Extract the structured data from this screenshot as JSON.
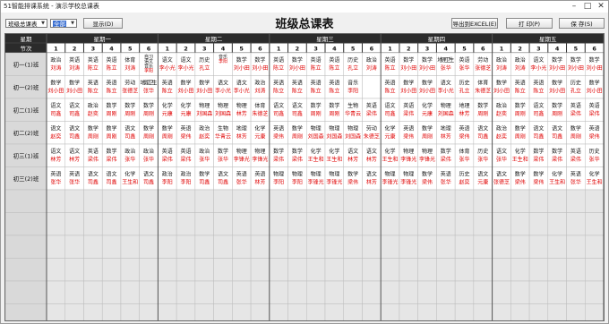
{
  "window": {
    "title": "51智能排课系统 - 演示学校总课表",
    "minimize_icon": "minimize-icon",
    "maximize_icon": "maximize-icon",
    "close_icon": "close-icon"
  },
  "toolbar": {
    "view_select": "班级总课表",
    "group_select": "全部",
    "show_label": "显示(D)",
    "export_label": "导出到EXCEL(E)",
    "print_label": "打 印(P)",
    "save_label": "保 存(S)"
  },
  "heading": "班级总课表",
  "table": {
    "corner_top": "星期",
    "corner_bottom": "节次",
    "days": [
      "星期一",
      "星期二",
      "星期三",
      "星期四",
      "星期五"
    ],
    "periods": [
      "1",
      "2",
      "3",
      "4",
      "5",
      "6"
    ],
    "rows": [
      {
        "label": "初一(1)班",
        "cells": [
          [
            "政治",
            "刘涛"
          ],
          [
            "英语",
            "刘涛"
          ],
          [
            "英语",
            "陈立"
          ],
          [
            "英语",
            "陈立"
          ],
          [
            "体育",
            "刘涛"
          ],
          [
            "自习|语文|音乐|李阳",
            ""
          ],
          [
            "语文",
            "李小光"
          ],
          [
            "语文",
            "李小光"
          ],
          [
            "历史",
            "孔立"
          ],
          [
            "音乐|李阳",
            ""
          ],
          [
            "数学",
            "刘小田"
          ],
          [
            "数学",
            "刘小田"
          ],
          [
            "英语",
            "陈立"
          ],
          [
            "数学",
            "刘小田"
          ],
          [
            "英语",
            "陈立"
          ],
          [
            "英语",
            "陈立"
          ],
          [
            "历史",
            "孔立"
          ],
          [
            "政治",
            "刘涛"
          ],
          [
            "英语",
            "陈立"
          ],
          [
            "数学",
            "刘小田"
          ],
          [
            "数学",
            "刘小田"
          ],
          [
            "地理卫生",
            "张华"
          ],
          [
            "英语",
            "张华"
          ],
          [
            "劳动",
            "张德芝"
          ],
          [
            "政治",
            "刘涛"
          ],
          [
            "政治",
            "刘涛"
          ],
          [
            "语文",
            "李小光"
          ],
          [
            "数学",
            "刘小田"
          ],
          [
            "数学",
            "刘小田"
          ],
          [
            "数学",
            "刘小田"
          ]
        ]
      },
      {
        "label": "初一(2)班",
        "cells": [
          [
            "数学",
            "刘小田"
          ],
          [
            "数学",
            "刘小田"
          ],
          [
            "英语",
            "陈立"
          ],
          [
            "英语",
            "陈立"
          ],
          [
            "劳动",
            "张德芝"
          ],
          [
            "地理卫生",
            "张华"
          ],
          [
            "英语",
            "陈立"
          ],
          [
            "数学",
            "刘小田"
          ],
          [
            "数学",
            "刘小田"
          ],
          [
            "语文",
            "李小光"
          ],
          [
            "语文",
            "李小光"
          ],
          [
            "政治",
            "刘涛"
          ],
          [
            "英语",
            "陈立"
          ],
          [
            "英语",
            "陈立"
          ],
          [
            "英语",
            "陈立"
          ],
          [
            "英语",
            "陈立"
          ],
          [
            "音乐",
            "李阳"
          ],
          [
            "",
            ""
          ],
          [
            "英语",
            "陈立"
          ],
          [
            "数学",
            "刘小田"
          ],
          [
            "数学",
            "刘小田"
          ],
          [
            "语文",
            "李小光"
          ],
          [
            "历史",
            "孔立"
          ],
          [
            "体育",
            "朱德芝"
          ],
          [
            "数学",
            "刘小田"
          ],
          [
            "英语",
            "陈立"
          ],
          [
            "英语",
            "陈立"
          ],
          [
            "数学",
            "刘小田"
          ],
          [
            "历史",
            "孔立"
          ],
          [
            "数学",
            "刘小田"
          ]
        ]
      },
      {
        "label": "初二(1)班",
        "cells": [
          [
            "语文",
            "司鑫"
          ],
          [
            "语文",
            "司鑫"
          ],
          [
            "政治",
            "赵奕"
          ],
          [
            "数学",
            "周刚"
          ],
          [
            "数学",
            "周刚"
          ],
          [
            "数学",
            "周刚"
          ],
          [
            "化学",
            "元康"
          ],
          [
            "化学",
            "元康"
          ],
          [
            "物理",
            "刘国森"
          ],
          [
            "物理",
            "刘国森"
          ],
          [
            "物理",
            "林芳"
          ],
          [
            "体育",
            "朱德芝"
          ],
          [
            "语文",
            "司鑫"
          ],
          [
            "语文",
            "司鑫"
          ],
          [
            "数学",
            "周刚"
          ],
          [
            "数学",
            "周刚"
          ],
          [
            "生物",
            "华青云"
          ],
          [
            "英语",
            "梁伟"
          ],
          [
            "语文",
            "司鑫"
          ],
          [
            "英语",
            "梁伟"
          ],
          [
            "化学",
            "元康"
          ],
          [
            "物理",
            "刘国森"
          ],
          [
            "地理",
            "林芳"
          ],
          [
            "数学",
            "周刚"
          ],
          [
            "政治",
            "赵奕"
          ],
          [
            "数学",
            "周刚"
          ],
          [
            "语文",
            "司鑫"
          ],
          [
            "数学",
            "周刚"
          ],
          [
            "英语",
            "梁伟"
          ],
          [
            "英语",
            "梁伟"
          ]
        ]
      },
      {
        "label": "初二(2)班",
        "cells": [
          [
            "语文",
            "赵奕"
          ],
          [
            "语文",
            "司鑫"
          ],
          [
            "数学",
            "周刚"
          ],
          [
            "数学",
            "周刚"
          ],
          [
            "语文",
            "司鑫"
          ],
          [
            "数学",
            "周刚"
          ],
          [
            "数学",
            "周刚"
          ],
          [
            "英语",
            "梁伟"
          ],
          [
            "政治",
            "赵奕"
          ],
          [
            "生物",
            "华青云"
          ],
          [
            "地理",
            "林芳"
          ],
          [
            "化学",
            "元康"
          ],
          [
            "英语",
            "梁伟"
          ],
          [
            "数学",
            "周刚"
          ],
          [
            "物理",
            "刘国森"
          ],
          [
            "物理",
            "刘国森"
          ],
          [
            "物理",
            "刘国森"
          ],
          [
            "劳动",
            "朱德芝"
          ],
          [
            "化学",
            "元康"
          ],
          [
            "英语",
            "梁伟"
          ],
          [
            "数学",
            "周刚"
          ],
          [
            "地理",
            "林芳"
          ],
          [
            "英语",
            "梁伟"
          ],
          [
            "语文",
            "司鑫"
          ],
          [
            "政治",
            "赵奕"
          ],
          [
            "数学",
            "周刚"
          ],
          [
            "语文",
            "司鑫"
          ],
          [
            "语文",
            "司鑫"
          ],
          [
            "数学",
            "周刚"
          ],
          [
            "英语",
            "梁伟"
          ]
        ]
      },
      {
        "label": "初三(1)班",
        "cells": [
          [
            "语文",
            "林芳"
          ],
          [
            "语文",
            "林芳"
          ],
          [
            "英语",
            "梁伟"
          ],
          [
            "数学",
            "梁伟"
          ],
          [
            "政治",
            "张华"
          ],
          [
            "政治",
            "张华"
          ],
          [
            "英语",
            "梁伟"
          ],
          [
            "英语",
            "梁伟"
          ],
          [
            "政治",
            "张华"
          ],
          [
            "数学",
            "张华"
          ],
          [
            "物理",
            "李锋光"
          ],
          [
            "物理",
            "李锋光"
          ],
          [
            "数学",
            "梁伟"
          ],
          [
            "数学",
            "梁伟"
          ],
          [
            "化学",
            "王生和"
          ],
          [
            "化学",
            "王生和"
          ],
          [
            "语文",
            "林芳"
          ],
          [
            "语文",
            "林芳"
          ],
          [
            "化学",
            "王生和"
          ],
          [
            "物理",
            "李锋光"
          ],
          [
            "物理",
            "李锋光"
          ],
          [
            "数学",
            "梁伟"
          ],
          [
            "体育",
            "张华"
          ],
          [
            "历史",
            "张华"
          ],
          [
            "语文",
            "张华"
          ],
          [
            "化学",
            "王生和"
          ],
          [
            "数学",
            "梁伟"
          ],
          [
            "数学",
            "梁伟"
          ],
          [
            "英语",
            "梁伟"
          ],
          [
            "历史",
            "张华"
          ]
        ]
      },
      {
        "label": "初三(2)班",
        "cells": [
          [
            "英语",
            "张华"
          ],
          [
            "英语",
            "张华"
          ],
          [
            "语文",
            "司鑫"
          ],
          [
            "语文",
            "司鑫"
          ],
          [
            "化学",
            "王生和"
          ],
          [
            "语文",
            "司鑫"
          ],
          [
            "政治",
            "李阳"
          ],
          [
            "政治",
            "李阳"
          ],
          [
            "数学",
            "司鑫"
          ],
          [
            "语文",
            "司鑫"
          ],
          [
            "英语",
            "张华"
          ],
          [
            "英语",
            "林芳"
          ],
          [
            "物理",
            "李阳"
          ],
          [
            "物理",
            "李阳"
          ],
          [
            "物理",
            "李锋光"
          ],
          [
            "物理",
            "李锋光"
          ],
          [
            "数学",
            "梁伟"
          ],
          [
            "语文",
            "林芳"
          ],
          [
            "物理",
            "李锋光"
          ],
          [
            "物理",
            "李锋光"
          ],
          [
            "数学",
            "梁伟"
          ],
          [
            "英语",
            "张华"
          ],
          [
            "历史",
            "赵奕"
          ],
          [
            "语文",
            "元康"
          ],
          [
            "语文",
            "张德芝"
          ],
          [
            "数学",
            "梁伟"
          ],
          [
            "数学",
            "梁伟"
          ],
          [
            "化学",
            "王生和"
          ],
          [
            "英语",
            "张华"
          ],
          [
            "化学",
            "王生和"
          ]
        ]
      },
      {
        "label": "",
        "cells": []
      },
      {
        "label": "",
        "cells": []
      },
      {
        "label": "",
        "cells": []
      },
      {
        "label": "",
        "cells": []
      },
      {
        "label": "",
        "cells": []
      },
      {
        "label": "",
        "cells": []
      }
    ]
  },
  "colors": {
    "header_bg": "#2b2b2b",
    "header_text": "#ffffff",
    "teacher_text": "#e00000",
    "subject_text": "#111111",
    "grid_line": "#bdbdbd",
    "label_bg": "#d9d9d9",
    "cell_bg": "#ffffff",
    "empty_bg": "#e6e6e6"
  }
}
